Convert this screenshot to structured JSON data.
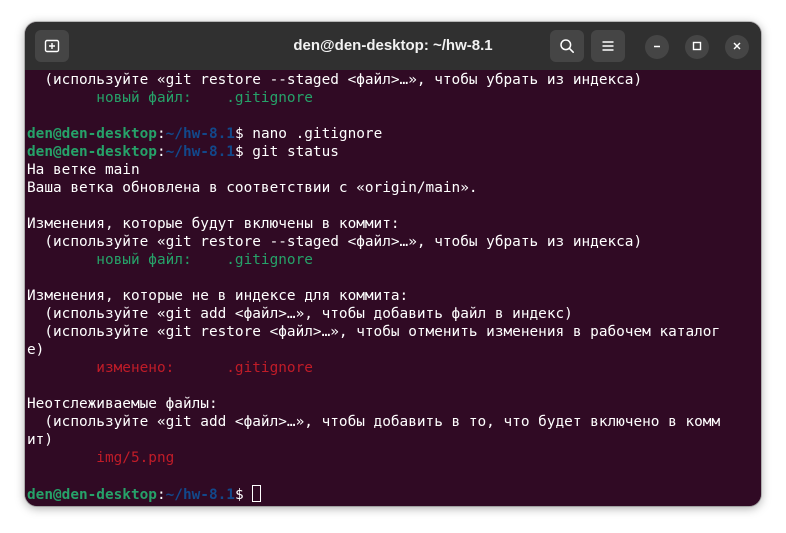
{
  "window": {
    "title": "den@den-desktop: ~/hw-8.1",
    "buttons": {
      "new_tab_icon": "new-tab-icon",
      "search_icon": "search-icon",
      "menu_icon": "hamburger-menu-icon",
      "minimize_icon": "minimize-icon",
      "maximize_icon": "maximize-icon",
      "close_icon": "close-icon"
    }
  },
  "colors": {
    "terminal_bg": "#300a24",
    "titlebar_bg": "#303030",
    "prompt_user": "#26a269",
    "prompt_path": "#12488b",
    "staged_file": "#26a269",
    "unstaged_file": "#c01c28"
  },
  "terminal": {
    "lines": [
      {
        "type": "text",
        "text": "  (используйте «git restore --staged <файл>…», чтобы убрать из индекса)"
      },
      {
        "type": "green",
        "text": "        новый файл:    .gitignore"
      },
      {
        "type": "blank",
        "text": ""
      },
      {
        "type": "prompt",
        "user": "den@den-desktop",
        "colon": ":",
        "path": "~/hw-8.1",
        "symbol": "$",
        "command": " nano .gitignore"
      },
      {
        "type": "prompt",
        "user": "den@den-desktop",
        "colon": ":",
        "path": "~/hw-8.1",
        "symbol": "$",
        "command": " git status"
      },
      {
        "type": "text",
        "text": "На ветке main"
      },
      {
        "type": "text",
        "text": "Ваша ветка обновлена в соответствии с «origin/main»."
      },
      {
        "type": "blank",
        "text": ""
      },
      {
        "type": "text",
        "text": "Изменения, которые будут включены в коммит:"
      },
      {
        "type": "text",
        "text": "  (используйте «git restore --staged <файл>…», чтобы убрать из индекса)"
      },
      {
        "type": "green",
        "text": "        новый файл:    .gitignore"
      },
      {
        "type": "blank",
        "text": ""
      },
      {
        "type": "text",
        "text": "Изменения, которые не в индексе для коммита:"
      },
      {
        "type": "text",
        "text": "  (используйте «git add <файл>…», чтобы добавить файл в индекс)"
      },
      {
        "type": "text",
        "text": "  (используйте «git restore <файл>…», чтобы отменить изменения в рабочем каталог"
      },
      {
        "type": "text",
        "text": "е)"
      },
      {
        "type": "red",
        "text": "        изменено:      .gitignore"
      },
      {
        "type": "blank",
        "text": ""
      },
      {
        "type": "text",
        "text": "Неотслеживаемые файлы:"
      },
      {
        "type": "text",
        "text": "  (используйте «git add <файл>…», чтобы добавить в то, что будет включено в комм"
      },
      {
        "type": "text",
        "text": "ит)"
      },
      {
        "type": "red",
        "text": "        img/5.png"
      },
      {
        "type": "blank",
        "text": ""
      },
      {
        "type": "prompt",
        "user": "den@den-desktop",
        "colon": ":",
        "path": "~/hw-8.1",
        "symbol": "$",
        "command": " ",
        "cursor": true
      }
    ]
  }
}
